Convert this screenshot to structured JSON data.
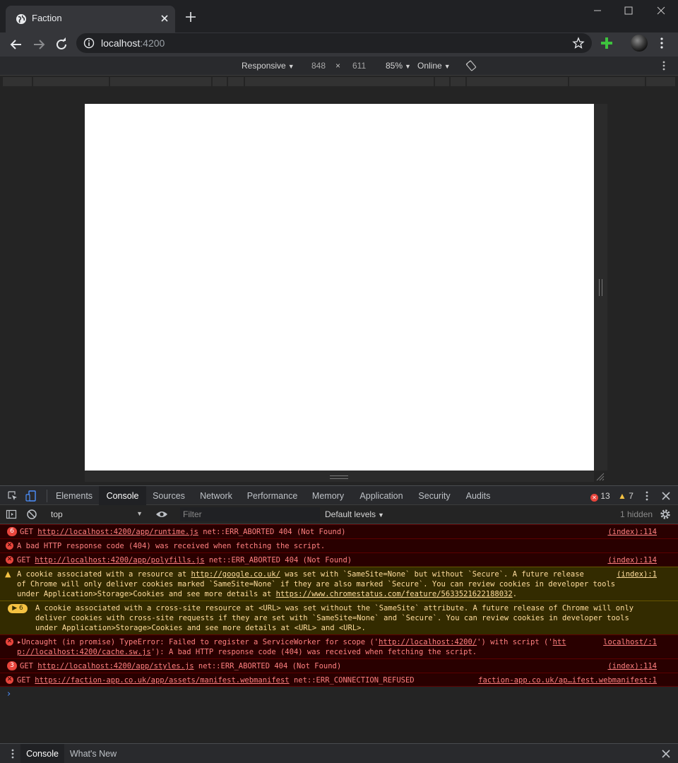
{
  "browser": {
    "tab_title": "Faction",
    "url_host": "localhost",
    "url_port": ":4200",
    "icons": [
      "globe-icon",
      "close-icon",
      "plus-icon",
      "minimize-icon",
      "maximize-icon",
      "back-arrow-icon",
      "forward-arrow-icon",
      "reload-icon",
      "info-icon",
      "star-icon",
      "extension-plus-icon",
      "avatar",
      "kebab-menu-icon"
    ]
  },
  "device_toolbar": {
    "mode": "Responsive",
    "width": "848",
    "times": "×",
    "height": "611",
    "zoom": "85%",
    "network": "Online"
  },
  "devtools": {
    "tabs": [
      "Elements",
      "Console",
      "Sources",
      "Network",
      "Performance",
      "Memory",
      "Application",
      "Security",
      "Audits"
    ],
    "active_tab": "Console",
    "error_count": "13",
    "warning_count": "7",
    "console_toolbar": {
      "context": "top",
      "filter_placeholder": "Filter",
      "levels": "Default levels",
      "hidden": "1 hidden"
    },
    "messages": [
      {
        "type": "error",
        "count": "6",
        "text_before": "GET ",
        "link": "http://localhost:4200/app/runtime.js",
        "text_after": " net::ERR_ABORTED 404 (Not Found)",
        "source": "(index):114"
      },
      {
        "type": "error",
        "text": "A bad HTTP response code (404) was received when fetching the script."
      },
      {
        "type": "error",
        "text_before": "GET ",
        "link": "http://localhost:4200/app/polyfills.js",
        "text_after": " net::ERR_ABORTED 404 (Not Found)",
        "source": "(index):114"
      },
      {
        "type": "warning",
        "line1_before": "A cookie associated with a resource at ",
        "line1_link": "http://google.co.uk/",
        "line1_after": " was set with `SameSite=None` but without `Secure`. A future release",
        "line2": "of Chrome will only deliver cookies marked `SameSite=None` if they are also marked `Secure`. You can review cookies in developer tools",
        "line3_before": "under Application>Storage>Cookies and see more details at ",
        "line3_link": "https://www.chromestatus.com/feature/5633521622188032",
        "line3_after": ".",
        "source": "(index):1"
      },
      {
        "type": "warning",
        "count": "6",
        "line1": "A cookie associated with a cross-site resource at <URL> was set without the `SameSite` attribute. A future release of Chrome will only",
        "line2": "deliver cookies with cross-site requests if they are set with `SameSite=None` and `Secure`. You can review cookies in developer tools",
        "line3": "under Application>Storage>Cookies and see more details at <URL> and <URL>."
      },
      {
        "type": "error",
        "line1_before": "Uncaught (in promise) TypeError: Failed to register a ServiceWorker for scope ('",
        "line1_link": "http://localhost:4200/",
        "line1_mid": "') with script ('",
        "line1_link2": "htt",
        "line2_link": "p://localhost:4200/cache.sw.js",
        "line2_after": "'): A bad HTTP response code (404) was received when fetching the script.",
        "source": "localhost/:1"
      },
      {
        "type": "error",
        "count": "3",
        "text_before": "GET ",
        "link": "http://localhost:4200/app/styles.js",
        "text_after": " net::ERR_ABORTED 404 (Not Found)",
        "source": "(index):114"
      },
      {
        "type": "error",
        "text_before": "GET ",
        "link": "https://faction-app.co.uk/app/assets/manifest.webmanifest",
        "text_after": " net::ERR_CONNECTION_REFUSED",
        "source": "faction-app.co.uk/ap…ifest.webmanifest:1"
      }
    ],
    "prompt": "›",
    "drawer_tabs": [
      "Console",
      "What's New"
    ]
  }
}
